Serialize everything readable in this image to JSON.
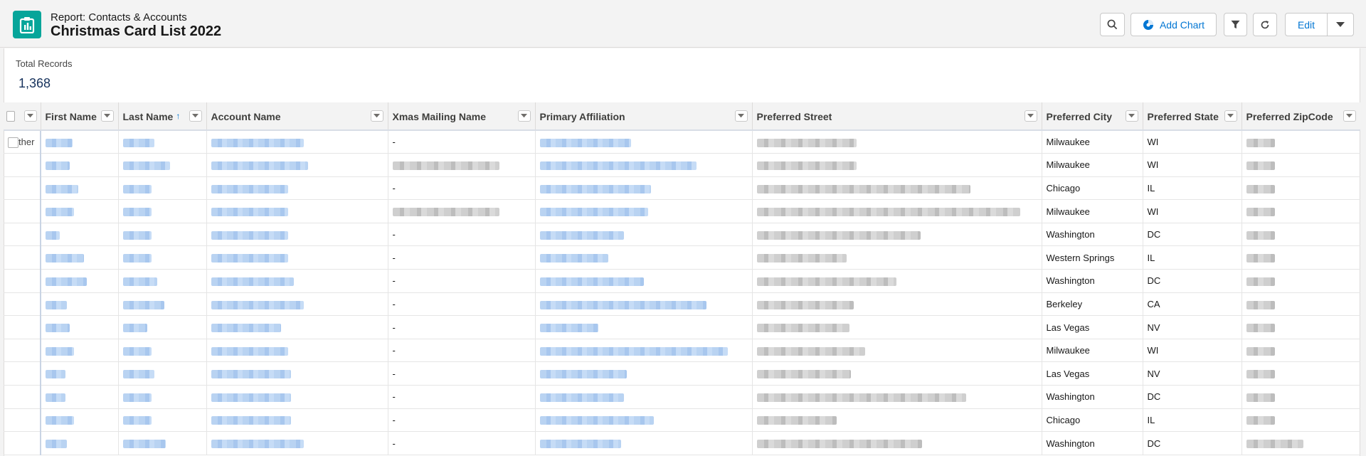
{
  "header": {
    "subtitle": "Report: Contacts & Accounts",
    "title": "Christmas Card List 2022",
    "add_chart_label": "Add Chart",
    "edit_label": "Edit"
  },
  "summary": {
    "total_label": "Total Records",
    "total_value": "1,368"
  },
  "table": {
    "columns": [
      "First Name",
      "Last Name",
      "Account Name",
      "Xmas Mailing Name",
      "Primary Affiliation",
      "Preferred Street",
      "Preferred City",
      "Preferred State",
      "Preferred ZipCode"
    ],
    "first_row_group_label": "ther",
    "rows": [
      {
        "xmas": "-",
        "city": "Milwaukee",
        "state": "WI"
      },
      {
        "xmas": "",
        "city": "Milwaukee",
        "state": "WI"
      },
      {
        "xmas": "-",
        "city": "Chicago",
        "state": "IL"
      },
      {
        "xmas": "",
        "city": "Milwaukee",
        "state": "WI"
      },
      {
        "xmas": "-",
        "city": "Washington",
        "state": "DC"
      },
      {
        "xmas": "-",
        "city": "Western Springs",
        "state": "IL"
      },
      {
        "xmas": "-",
        "city": "Washington",
        "state": "DC"
      },
      {
        "xmas": "-",
        "city": "Berkeley",
        "state": "CA"
      },
      {
        "xmas": "-",
        "city": "Las Vegas",
        "state": "NV"
      },
      {
        "xmas": "-",
        "city": "Milwaukee",
        "state": "WI"
      },
      {
        "xmas": "-",
        "city": "Las Vegas",
        "state": "NV"
      },
      {
        "xmas": "-",
        "city": "Washington",
        "state": "DC"
      },
      {
        "xmas": "-",
        "city": "Chicago",
        "state": "IL"
      },
      {
        "xmas": "-",
        "city": "Washington",
        "state": "DC"
      }
    ]
  },
  "colors": {
    "accent": "#0176d3",
    "app_icon": "#06a59a"
  },
  "icons": [
    "report-icon",
    "search-icon",
    "chart-icon",
    "filter-icon",
    "refresh-icon",
    "chevron-down-icon"
  ]
}
